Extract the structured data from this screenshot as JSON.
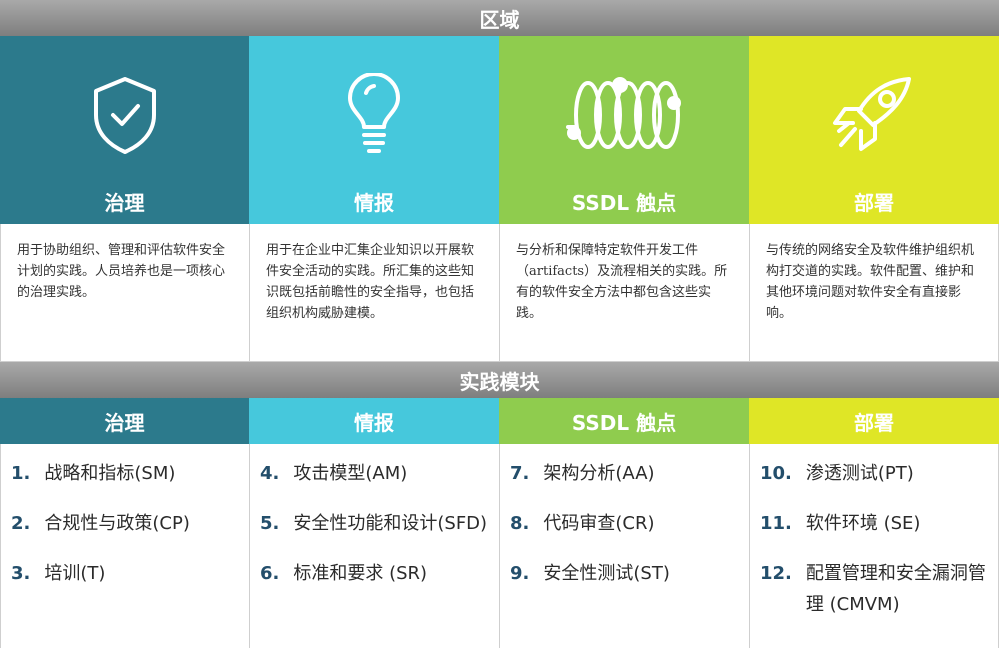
{
  "header_area": "区域",
  "header_practices": "实践模块",
  "colors": {
    "governance": "#2c7a8c",
    "intelligence": "#46c8dc",
    "ssdl": "#8fcc4e",
    "deployment": "#dfe626"
  },
  "areas": [
    {
      "title": "治理",
      "icon": "shield-check-icon",
      "desc": "用于协助组织、管理和评估软件安全计划的实践。人员培养也是一项核心的治理实践。"
    },
    {
      "title": "情报",
      "icon": "lightbulb-icon",
      "desc": "用于在企业中汇集企业知识以开展软件安全活动的实践。所汇集的这些知识既包括前瞻性的安全指导，也包括组织机构威胁建模。"
    },
    {
      "title": "SSDL 触点",
      "icon": "coil-loop-icon",
      "desc": "与分析和保障特定软件开发工件（artifacts）及流程相关的实践。所有的软件安全方法中都包含这些实践。"
    },
    {
      "title": "部署",
      "icon": "rocket-icon",
      "desc": "与传统的网络安全及软件维护组织机构打交道的实践。软件配置、维护和其他环境问题对软件安全有直接影响。"
    }
  ],
  "modules": [
    {
      "title": "治理",
      "items": [
        {
          "num": "1.",
          "text": "战略和指标(SM)"
        },
        {
          "num": "2.",
          "text": "合规性与政策(CP)"
        },
        {
          "num": "3.",
          "text": "培训(T)"
        }
      ]
    },
    {
      "title": "情报",
      "items": [
        {
          "num": "4.",
          "text": "攻击模型(AM)"
        },
        {
          "num": "5.",
          "text": "安全性功能和设计(SFD)"
        },
        {
          "num": "6.",
          "text": "标准和要求 (SR)"
        }
      ]
    },
    {
      "title": "SSDL 触点",
      "items": [
        {
          "num": "7.",
          "text": "架构分析(AA)"
        },
        {
          "num": "8.",
          "text": "代码审查(CR)"
        },
        {
          "num": "9.",
          "text": "安全性测试(ST)"
        }
      ]
    },
    {
      "title": "部署",
      "items": [
        {
          "num": "10.",
          "text": "渗透测试(PT)"
        },
        {
          "num": "11.",
          "text": "软件环境 (SE)"
        },
        {
          "num": "12.",
          "text": "配置管理和安全漏洞管理 (CMVM)"
        }
      ]
    }
  ]
}
